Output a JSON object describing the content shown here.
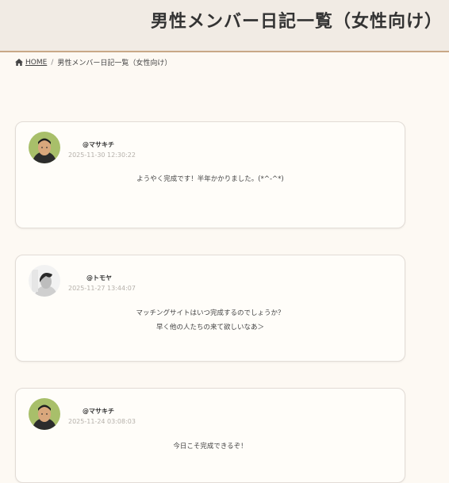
{
  "header": {
    "title": "男性メンバー日記一覧（女性向け）"
  },
  "breadcrumb": {
    "home_label": "HOME",
    "separator": "/",
    "current": "男性メンバー日記一覧（女性向け）"
  },
  "entries": [
    {
      "username": "@マサキチ",
      "timestamp": "2025-11-30 12:30:22",
      "lines": [
        "ようやく完成です！半年かかりました。(*^-^*)"
      ],
      "avatar": "avatar-masakichi"
    },
    {
      "username": "@トモヤ",
      "timestamp": "2025-11-27 13:44:07",
      "lines": [
        "マッチングサイトはいつ完成するのでしょうか？",
        "早く他の人たちの来て欲しいなあ＞"
      ],
      "avatar": "avatar-tomoya"
    },
    {
      "username": "@マサキチ",
      "timestamp": "2025-11-24 03:08:03",
      "lines": [
        "今日こそ完成できるぞ！"
      ],
      "avatar": "avatar-masakichi"
    }
  ],
  "colors": {
    "background": "#fdf9f3",
    "header_bg": "#f1ebe4",
    "header_border": "#c9a887",
    "timestamp": "#b5b0aa"
  }
}
